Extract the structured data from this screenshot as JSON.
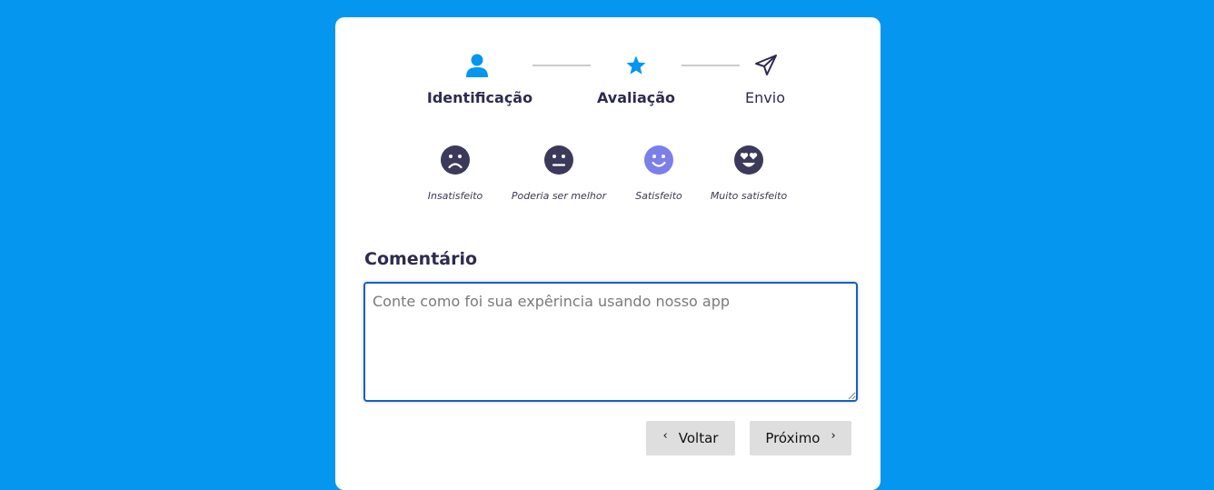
{
  "steps": [
    {
      "label": "Identificação",
      "icon": "user-icon",
      "state": "done",
      "color": "#0596f0"
    },
    {
      "label": "Avaliação",
      "icon": "star-icon",
      "state": "active",
      "color": "#0596f0"
    },
    {
      "label": "Envio",
      "icon": "send-icon",
      "state": "pending",
      "color": "#2e2b4f"
    }
  ],
  "ratings": [
    {
      "label": "Insatisfeito",
      "icon": "sad-face-icon",
      "selected": false
    },
    {
      "label": "Poderia ser melhor",
      "icon": "neutral-face-icon",
      "selected": false
    },
    {
      "label": "Satisfeito",
      "icon": "smile-face-icon",
      "selected": true
    },
    {
      "label": "Muito satisfeito",
      "icon": "heart-eyes-face-icon",
      "selected": false
    }
  ],
  "colors": {
    "background": "#0596f0",
    "primary": "#0596f0",
    "dark": "#2e2b4f",
    "selected_face": "#7b7fe8",
    "face": "#3b3a5a",
    "button_bg": "#dedede"
  },
  "comment": {
    "title": "Comentário",
    "placeholder": "Conte como foi sua expêrincia usando nosso app",
    "value": ""
  },
  "buttons": {
    "back_label": "Voltar",
    "next_label": "Próximo"
  }
}
